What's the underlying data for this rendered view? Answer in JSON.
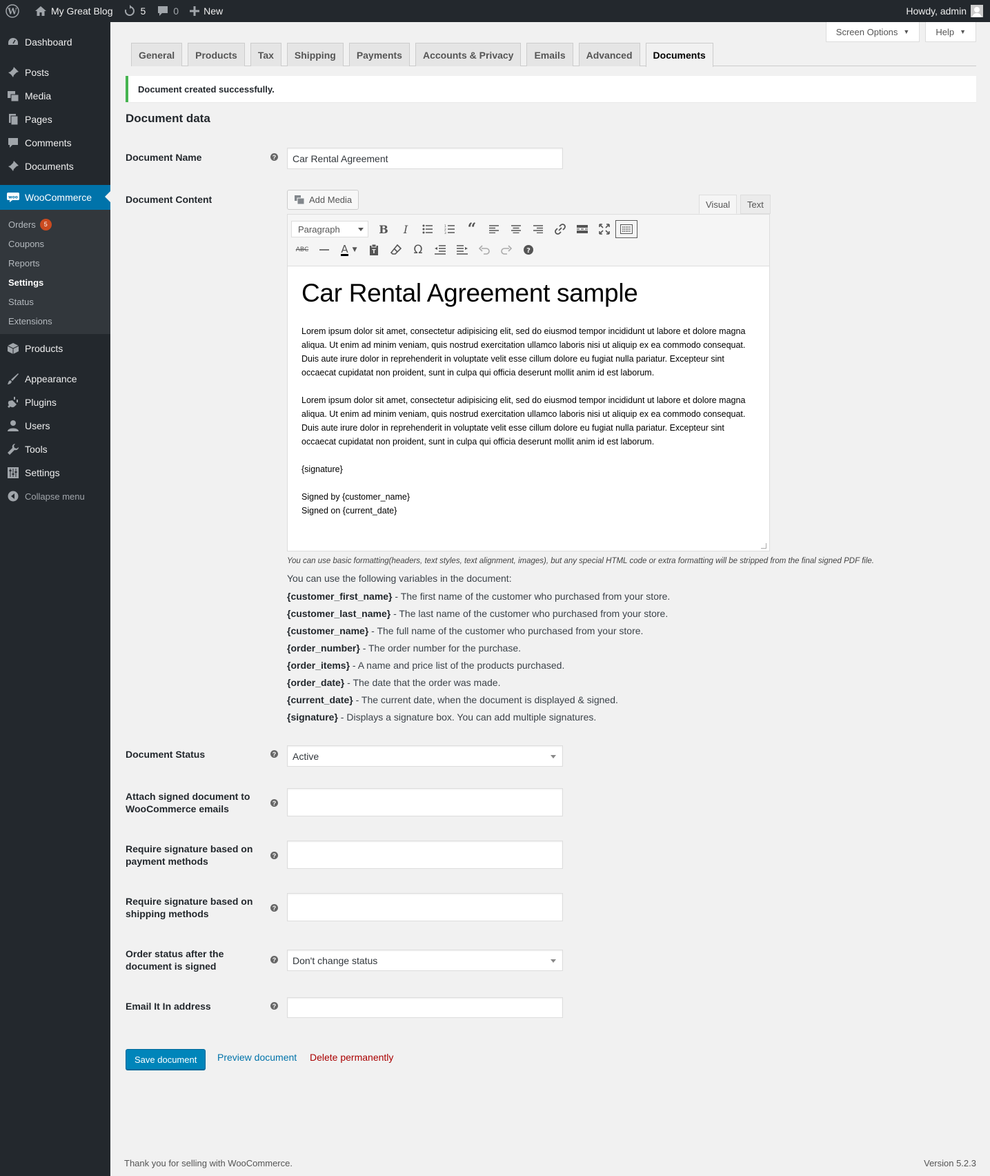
{
  "adminbar": {
    "site_name": "My Great Blog",
    "updates_count": "5",
    "comments_count": "0",
    "new_label": "New",
    "greeting": "Howdy, admin"
  },
  "sidebar": {
    "dashboard": "Dashboard",
    "posts": "Posts",
    "media": "Media",
    "pages": "Pages",
    "comments": "Comments",
    "documents": "Documents",
    "woocommerce": "WooCommerce",
    "sub": {
      "orders": "Orders",
      "orders_badge": "5",
      "coupons": "Coupons",
      "reports": "Reports",
      "settings": "Settings",
      "status": "Status",
      "extensions": "Extensions"
    },
    "products": "Products",
    "appearance": "Appearance",
    "plugins": "Plugins",
    "users": "Users",
    "tools": "Tools",
    "settings": "Settings",
    "collapse": "Collapse menu"
  },
  "screen_options": {
    "screen_options_label": "Screen Options",
    "help_label": "Help"
  },
  "tabs": [
    "General",
    "Products",
    "Tax",
    "Shipping",
    "Payments",
    "Accounts & Privacy",
    "Emails",
    "Advanced",
    "Documents"
  ],
  "notice": "Document created successfully.",
  "section_title": "Document data",
  "form": {
    "name_label": "Document Name",
    "name_value": "Car Rental Agreement",
    "content_label": "Document Content",
    "add_media": "Add Media",
    "tab_visual": "Visual",
    "tab_text": "Text",
    "format_select": "Paragraph",
    "status_label": "Document Status",
    "status_value": "Active",
    "attach_label": "Attach signed document to WooCommerce emails",
    "attach_value": "",
    "payment_label": "Require signature based on payment methods",
    "payment_value": "",
    "shipping_label": "Require signature based on shipping methods",
    "shipping_value": "",
    "order_status_label": "Order status after the document is signed",
    "order_status_value": "Don't change status",
    "email_label": "Email It In address",
    "email_value": ""
  },
  "editor_content": {
    "heading": "Car Rental Agreement sample",
    "paragraph1": "Lorem ipsum dolor sit amet, consectetur adipisicing elit, sed do eiusmod tempor incididunt ut labore et dolore magna aliqua. Ut enim ad minim veniam, quis nostrud exercitation ullamco laboris nisi ut aliquip ex ea commodo consequat. Duis aute irure dolor in reprehenderit in voluptate velit esse cillum dolore eu fugiat nulla pariatur. Excepteur sint occaecat cupidatat non proident, sunt in culpa qui officia deserunt mollit anim id est laborum.",
    "paragraph2": "Lorem ipsum dolor sit amet, consectetur adipisicing elit, sed do eiusmod tempor incididunt ut labore et dolore magna aliqua. Ut enim ad minim veniam, quis nostrud exercitation ullamco laboris nisi ut aliquip ex ea commodo consequat. Duis aute irure dolor in reprehenderit in voluptate velit esse cillum dolore eu fugiat nulla pariatur. Excepteur sint occaecat cupidatat non proident, sunt in culpa qui officia deserunt mollit anim id est laborum.",
    "signature": "{signature}",
    "signed_by": "Signed by {customer_name}",
    "signed_on": "Signed on {current_date}"
  },
  "description": "You can use basic formatting(headers, text styles, text alignment, images), but any special HTML code or extra formatting will be stripped from the final signed PDF file.",
  "variables_intro": "You can use the following variables in the document:",
  "variables": [
    {
      "name": "{customer_first_name}",
      "desc": " - The first name of the customer who purchased from your store."
    },
    {
      "name": "{customer_last_name}",
      "desc": " - The last name of the customer who purchased from your store."
    },
    {
      "name": "{customer_name}",
      "desc": " - The full name of the customer who purchased from your store."
    },
    {
      "name": "{order_number}",
      "desc": " - The order number for the purchase."
    },
    {
      "name": "{order_items}",
      "desc": " - A name and price list of the products purchased."
    },
    {
      "name": "{order_date}",
      "desc": " - The date that the order was made."
    },
    {
      "name": "{current_date}",
      "desc": " - The current date, when the document is displayed & signed."
    },
    {
      "name": "{signature}",
      "desc": " - Displays a signature box. You can add multiple signatures."
    }
  ],
  "actions": {
    "save": "Save document",
    "preview": "Preview document",
    "delete": "Delete permanently"
  },
  "footer": {
    "thanks": "Thank you for selling with WooCommerce.",
    "version": "Version 5.2.3"
  },
  "colors": {
    "primary": "#0085ba",
    "link": "#0073aa",
    "delete": "#a00",
    "notice_success": "#46b450",
    "menu_bg": "#23282d"
  }
}
